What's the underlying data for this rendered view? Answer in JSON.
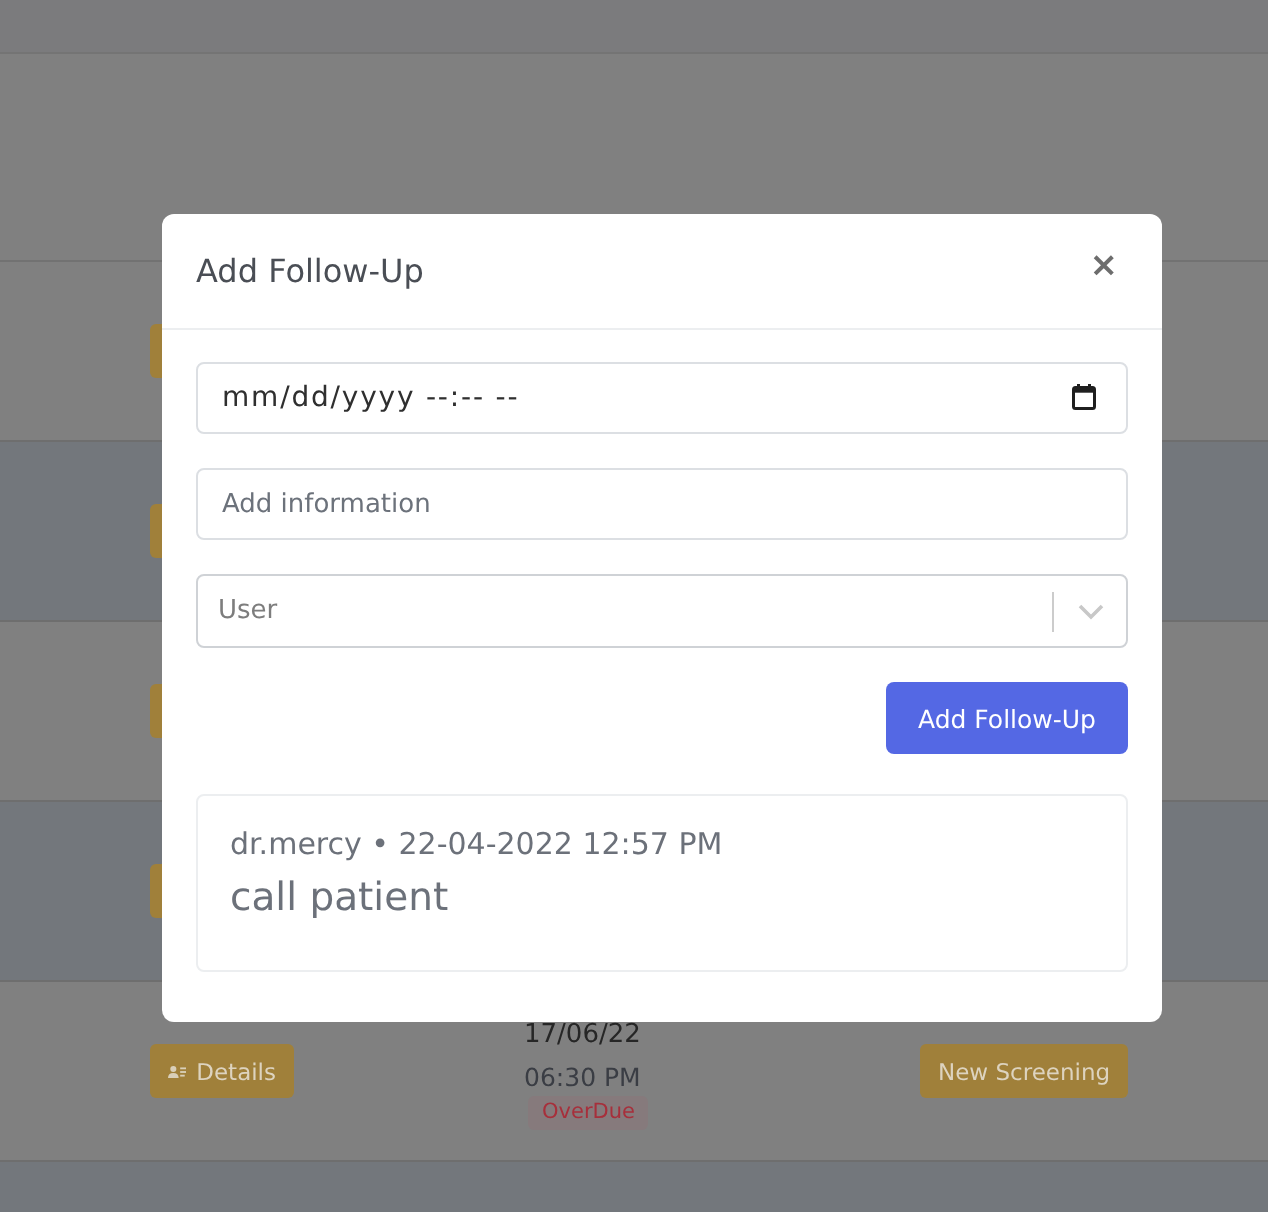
{
  "table": {
    "rows": [
      {
        "kind": "covered"
      },
      {
        "kind": "covered"
      },
      {
        "kind": "covered"
      },
      {
        "kind": "covered"
      },
      {
        "kind": "full",
        "details_button": "Details",
        "date": "17/06/22",
        "time": "06:30 PM",
        "status": "OverDue",
        "action_button": "New Screening"
      },
      {
        "kind": "partial"
      }
    ]
  },
  "modal": {
    "title": "Add Follow-Up",
    "close": "×",
    "fields": [
      {
        "kind": "datetime",
        "placeholder": "mm/dd/yyyy --:-- --"
      },
      {
        "kind": "text",
        "placeholder": "Add information"
      },
      {
        "kind": "select",
        "placeholder": "User"
      }
    ],
    "submit": "Add Follow-Up",
    "notes": [
      {
        "meta": "dr.mercy • 22-04-2022 12:57 PM",
        "text": "call patient"
      }
    ]
  }
}
